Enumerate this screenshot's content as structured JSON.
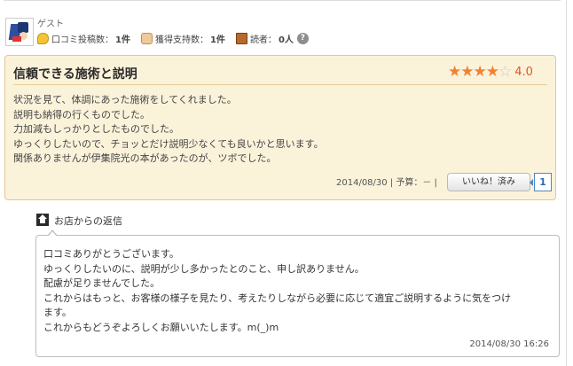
{
  "reviewer": {
    "name": "ゲスト",
    "posts_label": "口コミ投稿数：",
    "posts_value": "1件",
    "support_label": "獲得支持数：",
    "support_value": "1件",
    "readers_label": "読者：",
    "readers_value": "0人",
    "help_glyph": "?"
  },
  "review": {
    "title": "信頼できる施術と説明",
    "rating": 4.0,
    "rating_text": "4.0",
    "stars_total": 5,
    "stars_filled": 4,
    "star_color": "#f2812f",
    "lines": [
      "状況を見て、体調にあった施術をしてくれました。",
      "説明も納得の行くものでした。",
      "力加減もしっかりとしたものでした。",
      "ゆっくりしたいので、チョッとだけ説明少なくても良いかと思います。",
      "関係ありませんが伊集院光の本があったのが、ツボでした。"
    ],
    "date_budget": "2014/08/30 | 予算：－ |",
    "like_button": "いいね！済み",
    "like_count": "1"
  },
  "reply": {
    "heading": "お店からの返信",
    "lines": [
      "口コミありがとうございます。",
      "ゆっくりしたいのに、説明が少し多かったとのこと、申し訳ありません。",
      "配慮が足りませんでした。",
      "これからはもっと、お客様の様子を見たり、考えたりしながら必要に応じて適宜ご説明するように気をつけ",
      "ます。",
      "これからもどうぞよろしくお願いいたします。m(_)m"
    ],
    "datetime": "2014/08/30 16:26"
  }
}
